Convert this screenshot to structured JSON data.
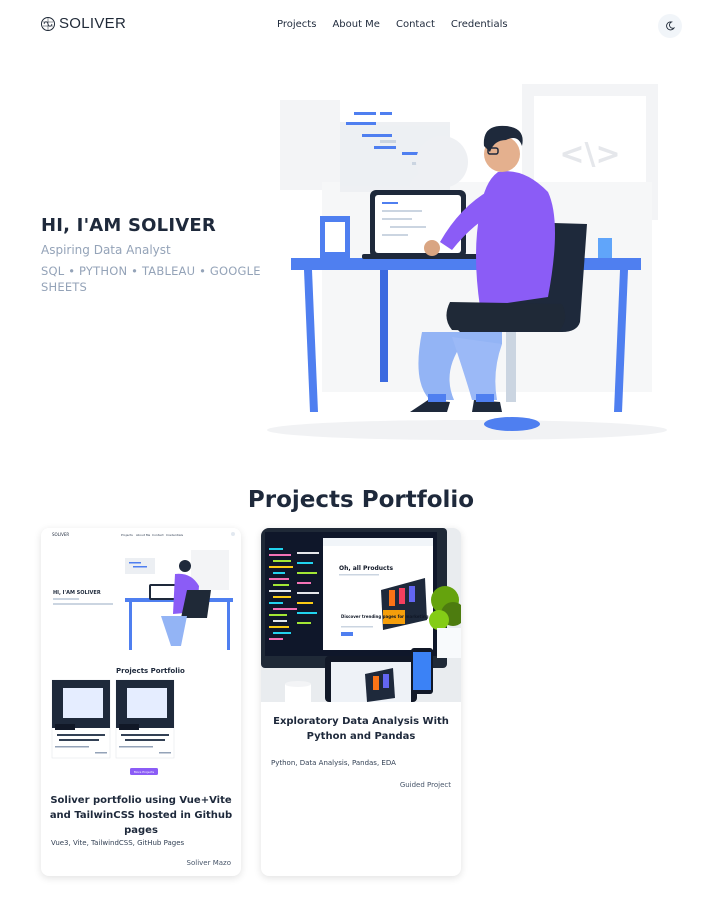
{
  "nav": {
    "logo": "SOLIVER",
    "links": [
      "Projects",
      "About Me",
      "Contact",
      "Credentials"
    ]
  },
  "hero": {
    "title": "HI, I'AM SOLIVER",
    "subtitle": "Aspiring Data Analyst",
    "skills": "SQL • PYTHON • TABLEAU • GOOGLE SHEETS",
    "illustration_code": "<\\>"
  },
  "projects": {
    "title": "Projects Portfolio",
    "cards": [
      {
        "title": "Soliver portfolio using Vue+Vite and TailwinCSS hosted in Github pages",
        "tags": "Vue3, Vite, TailwindCSS, GitHub Pages",
        "author": "Soliver Mazo"
      },
      {
        "title": "Exploratory Data Analysis With Python and Pandas",
        "tags": "Python, Data Analysis, Pandas, EDA",
        "author": "Guided Project"
      }
    ],
    "mini": {
      "logo": "SOLIVER",
      "links": [
        "Projects",
        "About Me",
        "Contact",
        "Credentials"
      ],
      "hero_title": "HI, I'AM SOLIVER",
      "section_title": "Projects Portfolio",
      "button": "More Projects"
    },
    "screen": {
      "headline": "Oh, all Products",
      "promo": "Discover trending pages for marketing"
    }
  },
  "colors": {
    "accent": "#4f7ff0",
    "purple": "#8b5cf6",
    "text": "#1e293b",
    "muted": "#94a3b8"
  }
}
